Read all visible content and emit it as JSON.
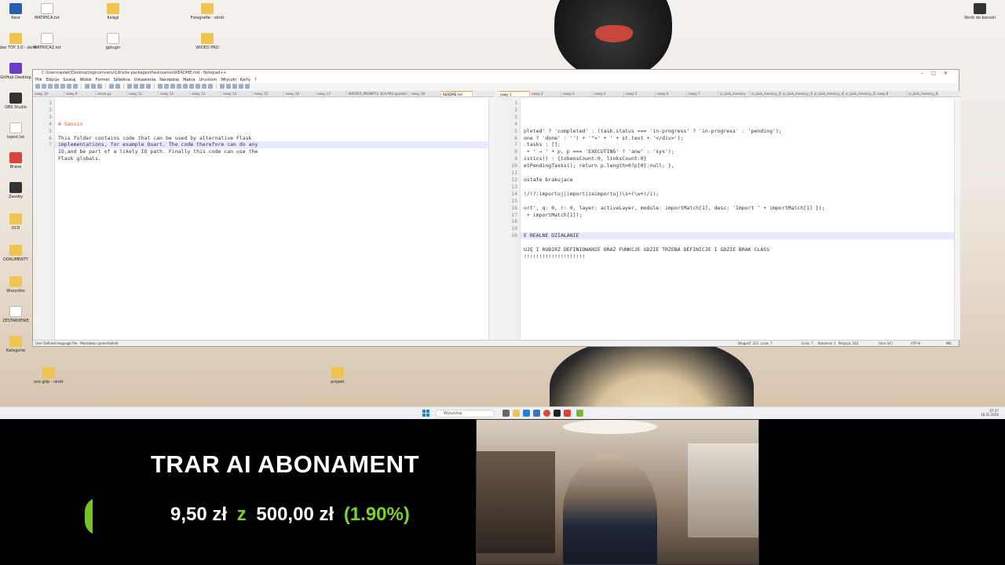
{
  "desktop": {
    "icons_left": [
      {
        "label": "Kosz",
        "kind": "app"
      },
      {
        "label": "Wideo TOY 3.0 - skrót",
        "kind": "folder"
      },
      {
        "label": "GitHub Desktop",
        "kind": "app4"
      },
      {
        "label": "OBS Studio",
        "kind": "app2"
      },
      {
        "label": "tojest.txt",
        "kind": "doc"
      },
      {
        "label": "Brave",
        "kind": "app3"
      },
      {
        "label": "Zasoby",
        "kind": "app2"
      },
      {
        "label": "OCR",
        "kind": "folder"
      },
      {
        "label": "DOKUMENTY",
        "kind": "folder"
      },
      {
        "label": "Wszystko",
        "kind": "folder"
      },
      {
        "label": "ZESTAWIENIE",
        "kind": "doc"
      },
      {
        "label": "Kategorie",
        "kind": "folder"
      }
    ],
    "icons_top": [
      {
        "label": "MATRYCA.txt",
        "kind": "doc"
      },
      {
        "label": "MATRYCA2.txt",
        "kind": "doc"
      },
      {
        "label": "Księgi",
        "kind": "folder"
      },
      {
        "label": "gplugin",
        "kind": "doc"
      },
      {
        "label": "Fotografie - skrót",
        "kind": "folder"
      },
      {
        "label": "WIDEO PRO",
        "kind": "folder"
      }
    ],
    "icons_lower": [
      {
        "label": "pro-gtip - skrót",
        "kind": "folder"
      },
      {
        "label": "projekt",
        "kind": "folder"
      }
    ],
    "icon_top_right": {
      "label": "Skrót do konsoli"
    }
  },
  "notepad": {
    "title": "C:\\Users\\wzwk\\Desktop\\logicon\\venv\\Lib\\site-packages\\flask\\sansio\\README.md - Notepad++",
    "menu": [
      "Plik",
      "Edycja",
      "Szukaj",
      "Widok",
      "Format",
      "Składnia",
      "Ustawienia",
      "Narzędzia",
      "Makra",
      "Uruchom",
      "Wtyczki",
      "Karty",
      "?"
    ],
    "left_tabs": [
      "nowy 10",
      "nowy 9",
      "ekran.py",
      "nowy 11",
      "nowy 12",
      "nowy 13",
      "nowy 14",
      "nowy 15",
      "nowy 16",
      "nowy 17",
      "MASTER_PROMPT.txt",
      "SCA PRO guidelin",
      "nowy 18",
      "README.md"
    ],
    "right_tabs": [
      "nowy 1",
      "nowy 2",
      "nowy 3",
      "nowy 4",
      "nowy 5",
      "nowy 6",
      "nowy 7",
      "ai_task_memory",
      "ai_task_memory_2",
      "ai_task_memory_3",
      "ai_task_memory_4",
      "ai_task_memory_5",
      "nowy 8",
      "ai_task_memory_6"
    ],
    "left_code": [
      "# Sansio",
      "",
      "This folder contains code that can be used by alternative Flask",
      "implementations, for example Quart. The code therefore can do any",
      "IO,and be part of a likely IO path. Finally this code can use the",
      "Flask globals.",
      ""
    ],
    "right_code": [
      "",
      "pleted' ? 'completed' : (task.status === 'in-progress' ? 'in-progress' : 'pending');",
      "one ? 'done' : '') + '\">' + ' + st.text + '</div>');",
      ".tasks : [];",
      " + ' → ' + p, p === 'EXECUTING' ? 'anw' : 'sys');",
      "istics() : {tokensCount:0, linksCount:0}",
      "etPendingTasks(); return p.length>0?p[0]:null; },",
      "",
      "ostałe brakujace",
      "",
      "(/(?:importuj|import|zaimportuj)\\s+(\\w+)/i);",
      "",
      "ort', q: 0, r: 0, layer: activeLayer, module: importMatch[1], desc: 'Import ' + importMatch[1] });",
      " + importMatch[1]);",
      "",
      "",
      "E REALNE DZIAŁANIE",
      "",
      "UJĘ I ROBIRZ DEFINIOWANIE ORAZ FUNKCJE GDZIE TRZEBA DEFINICJE I GDZIE BRAK CLASS",
      "!!!!!!!!!!!!!!!!!!!!"
    ],
    "status": {
      "lang": "User Defined language file - Markdown (preinstalled)",
      "length": "Długość: 221",
      "lines": "Linie: 7",
      "line": "Linia: 7",
      "col": "Kolumna: 1",
      "pos": "Pozycja: 222",
      "eol": "Unix (LF)",
      "enc": "UTF-8",
      "mode": "INS"
    }
  },
  "taskbar": {
    "search_placeholder": "Wyszukaj",
    "time": "07:37",
    "date": "18.02.2026"
  },
  "overlay": {
    "goal_title": "TRAR AI ABONAMENT",
    "current": "9,50 zł",
    "separator": "z",
    "target": "500,00 zł",
    "percent": "(1.90%)",
    "progress_fraction": 0.019,
    "accent": "#7ad22a"
  }
}
